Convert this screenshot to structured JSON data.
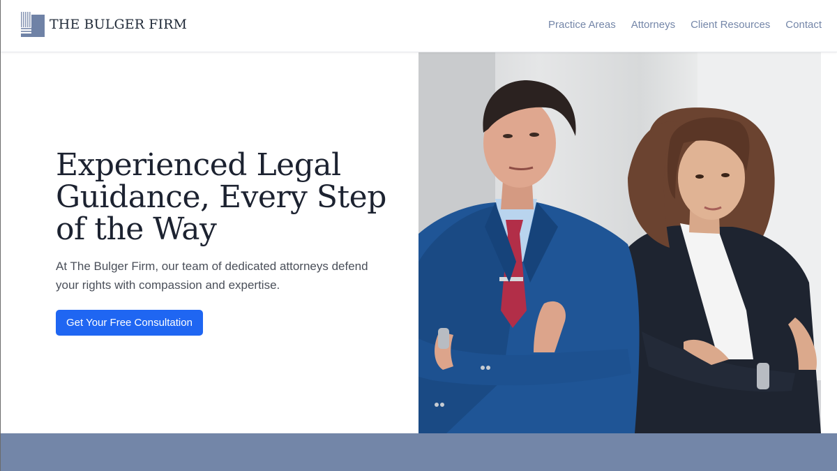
{
  "brand": {
    "name": "THE BULGER FIRM",
    "logo_icon": "columns-logo-icon"
  },
  "nav": {
    "items": [
      {
        "label": "Practice Areas"
      },
      {
        "label": "Attorneys"
      },
      {
        "label": "Client Resources"
      },
      {
        "label": "Contact"
      }
    ]
  },
  "hero": {
    "headline": "Experienced Legal Guidance, Every Step of the Way",
    "subtext": "At The Bulger Firm, our team of dedicated attorneys defend your rights with compassion and expertise.",
    "cta_label": "Get Your Free Consultation",
    "image_alt": "Two attorneys, a man in a blue suit and a woman in a dark suit, standing with arms crossed"
  },
  "colors": {
    "nav_text": "#7486a8",
    "cta_bg": "#1f66f2",
    "band": "#7386a8",
    "headline": "#1c2230"
  }
}
